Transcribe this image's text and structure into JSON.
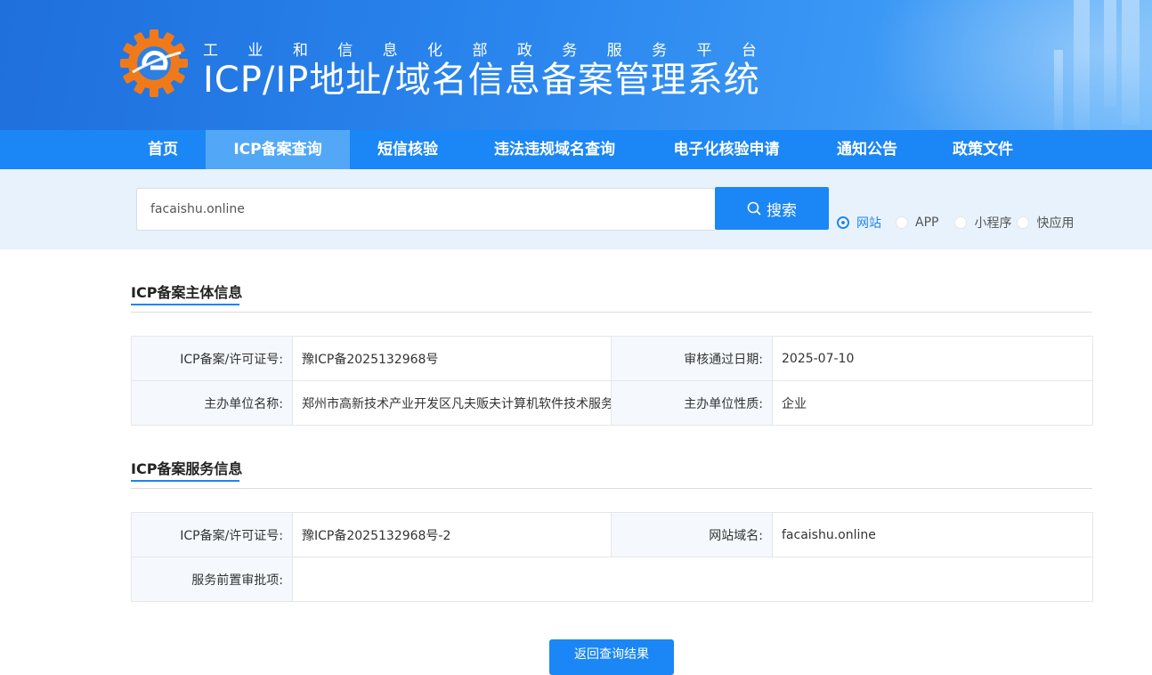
{
  "header": {
    "subtitle_chars": [
      "工",
      "业",
      "和",
      "信",
      "息",
      "化",
      "部",
      "政",
      "务",
      "服",
      "务",
      "平",
      "台"
    ],
    "title": "ICP/IP地址/域名信息备案管理系统"
  },
  "nav": {
    "items": [
      "首页",
      "ICP备案查询",
      "短信核验",
      "违法违规域名查询",
      "电子化核验申请",
      "通知公告",
      "政策文件"
    ],
    "active_index": 1
  },
  "search": {
    "value": "facaishu.online",
    "button_label": "搜索",
    "types": [
      {
        "label": "网站",
        "checked": true
      },
      {
        "label": "APP",
        "checked": false
      },
      {
        "label": "小程序",
        "checked": false
      },
      {
        "label": "快应用",
        "checked": false
      }
    ]
  },
  "subject_section": {
    "title": "ICP备案主体信息",
    "rows": [
      {
        "k1": "ICP备案/许可证号:",
        "v1": "豫ICP备2025132968号",
        "k2": "审核通过日期:",
        "v2": "2025-07-10"
      },
      {
        "k1": "主办单位名称:",
        "v1": "郑州市高新技术产业开发区凡夫贩夫计算机软件技术服务",
        "k2": "主办单位性质:",
        "v2": "企业"
      }
    ]
  },
  "service_section": {
    "title": "ICP备案服务信息",
    "rows": [
      {
        "k1": "ICP备案/许可证号:",
        "v1": "豫ICP备2025132968号-2",
        "k2": "网站域名:",
        "v2": "facaishu.online"
      },
      {
        "k1": "服务前置审批项:",
        "v1": ""
      }
    ]
  },
  "back_button": "返回查询结果",
  "colors": {
    "primary": "#1b86f5",
    "nav_active": "#52a8f7",
    "strip": "#e8f2fc"
  }
}
